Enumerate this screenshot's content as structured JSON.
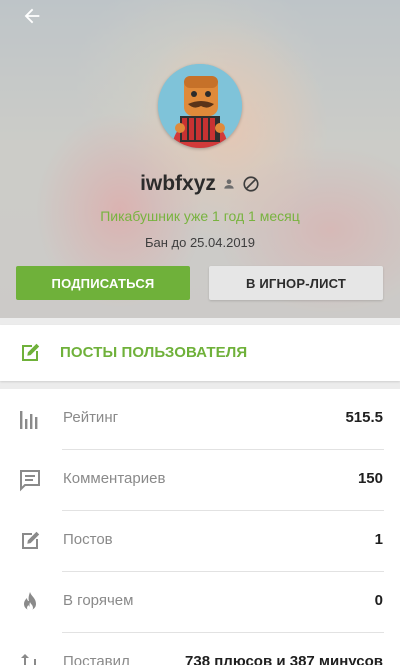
{
  "header": {
    "username": "iwbfxyz",
    "since": "Пикабушник уже 1 год 1 месяц",
    "ban": "Бан до 25.04.2019",
    "subscribe_label": "ПОДПИСАТЬСЯ",
    "ignore_label": "В ИГНОР-ЛИСТ"
  },
  "posts": {
    "label": "ПОСТЫ ПОЛЬЗОВАТЕЛЯ",
    "icon": "edit-square-icon"
  },
  "stats": [
    {
      "icon": "bar-chart-icon",
      "label": "Рейтинг",
      "value": "515.5"
    },
    {
      "icon": "comment-icon",
      "label": "Комментариев",
      "value": "150"
    },
    {
      "icon": "edit-square-icon",
      "label": "Постов",
      "value": "1"
    },
    {
      "icon": "flame-icon",
      "label": "В горячем",
      "value": "0"
    },
    {
      "icon": "swap-vertical-icon",
      "label": "Поставил",
      "value": "738 плюсов и 387 минусов"
    }
  ],
  "colors": {
    "accent_green": "#6fb13a",
    "since_green": "#78b33f",
    "icon_gray": "#8a8a8a"
  }
}
